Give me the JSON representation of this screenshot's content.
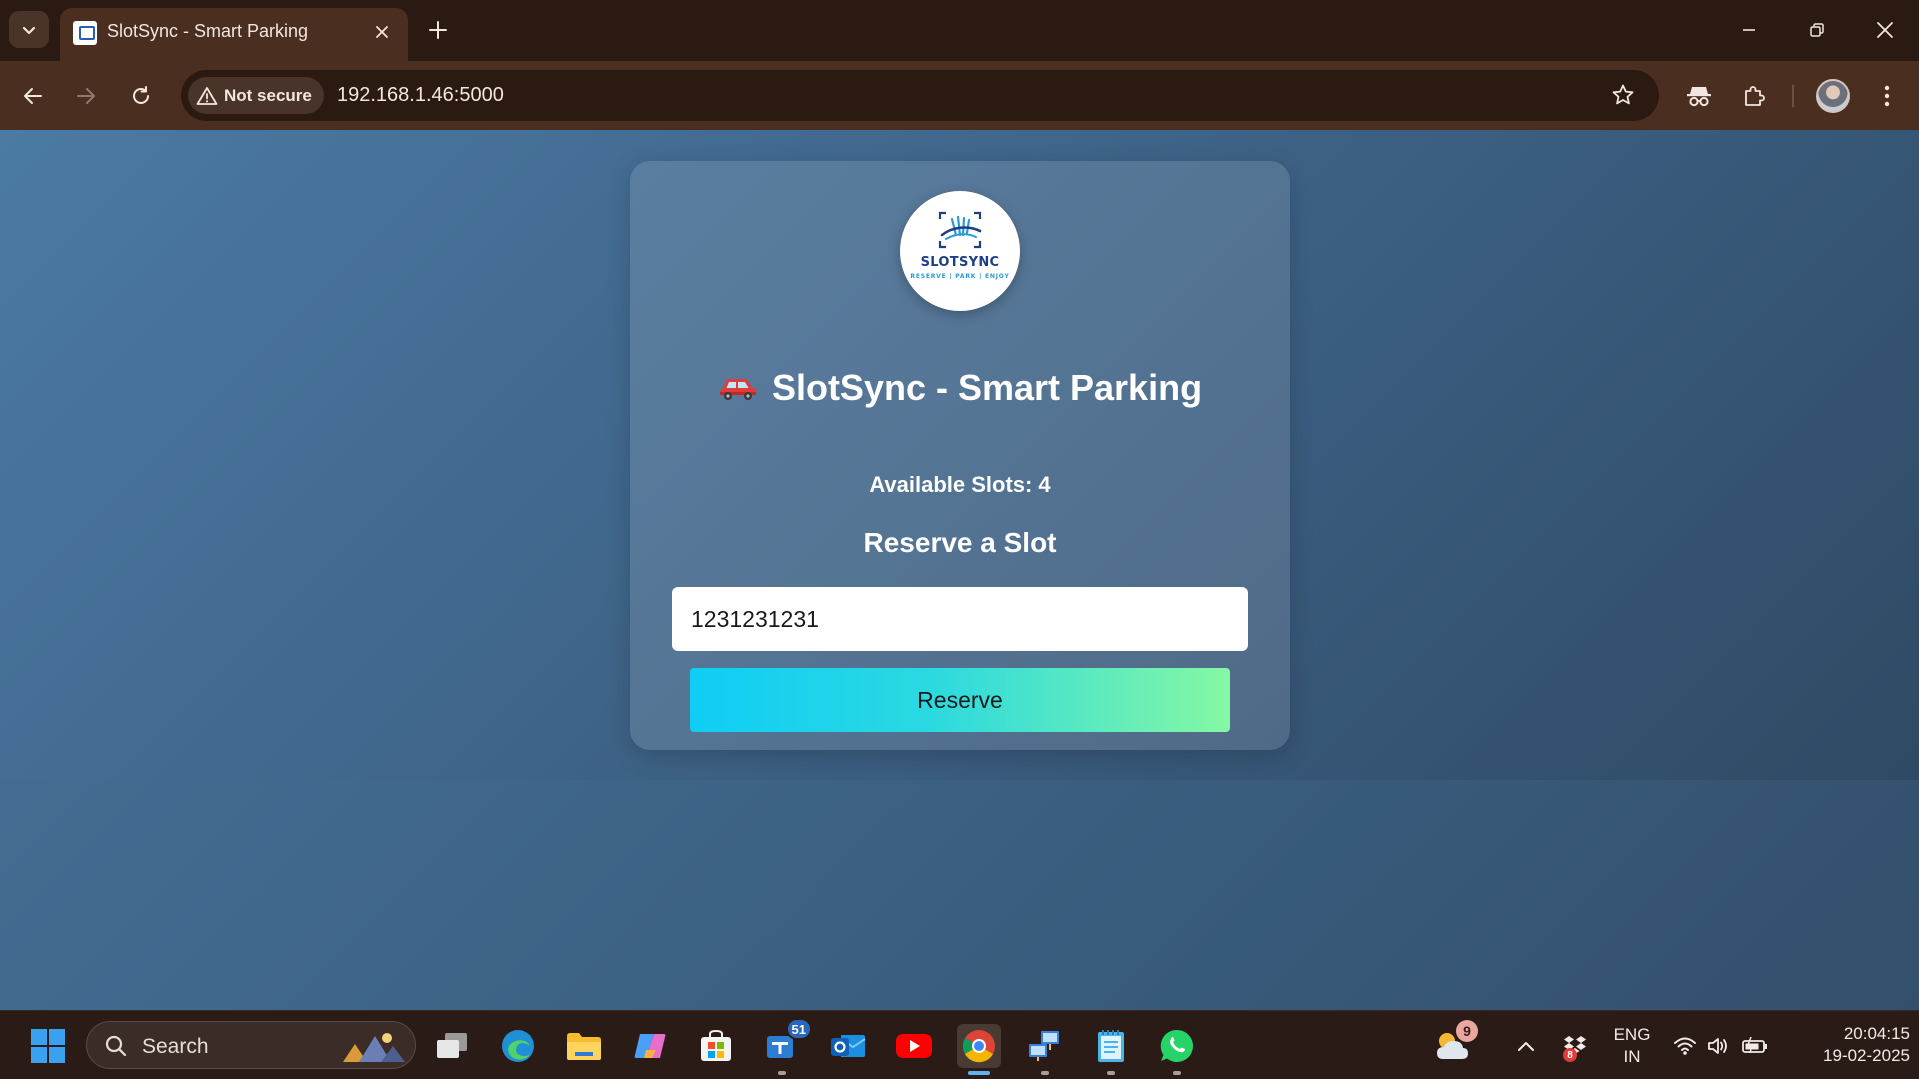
{
  "browser": {
    "tab": {
      "title": "SlotSync - Smart Parking"
    },
    "address": {
      "security_label": "Not secure",
      "url": "192.168.1.46:5000"
    }
  },
  "page": {
    "logo": {
      "name": "SLOTSYNC",
      "tagline": "RESERVE | PARK | ENJOY"
    },
    "title_icon": "car-icon",
    "title": "SlotSync - Smart Parking",
    "available_label": "Available Slots:",
    "available_count": "4",
    "reserve_heading": "Reserve a Slot",
    "phone_input_value": "1231231231",
    "reserve_button_label": "Reserve",
    "colors": {
      "button_gradient_start": "#0fcdf5",
      "button_gradient_end": "#86f8a2",
      "card_bg": "rgba(255,255,255,0.12)"
    }
  },
  "taskbar": {
    "search_label": "Search",
    "badges": {
      "teams": "51",
      "weather": "9",
      "dropbox": "8"
    },
    "language": {
      "line1": "ENG",
      "line2": "IN"
    },
    "clock": {
      "time": "20:04:15",
      "date": "19-02-2025"
    }
  }
}
